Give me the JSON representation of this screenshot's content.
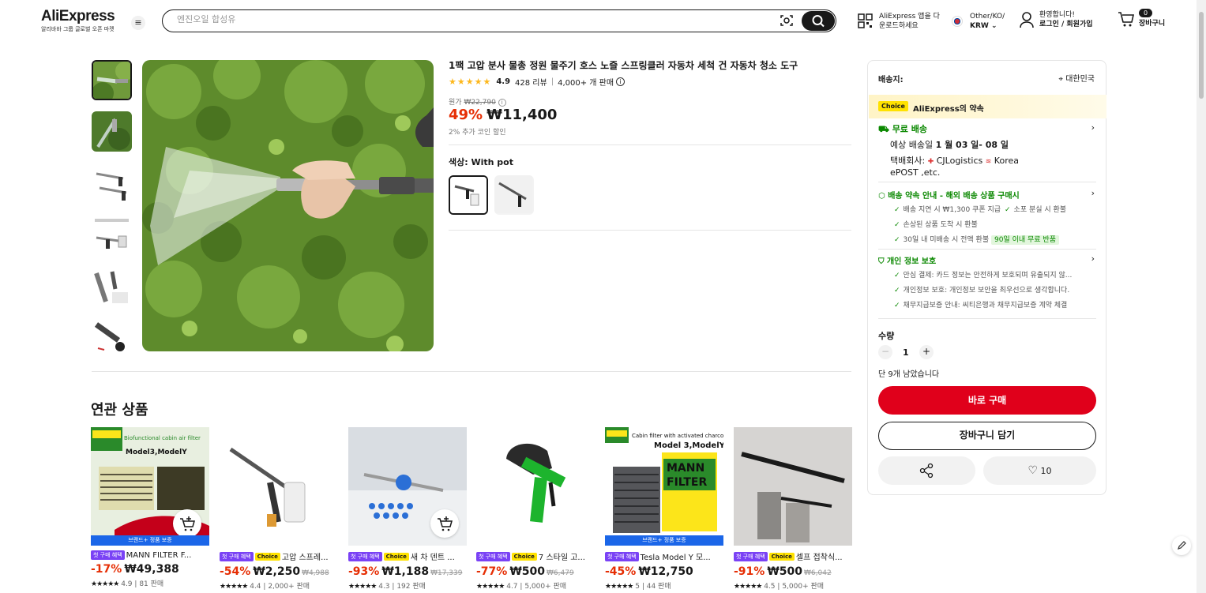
{
  "header": {
    "logo": "AliExpress",
    "logo_sub": "알리바바 그룹 글로벌 오픈 마켓",
    "search_placeholder": "엔진오일 합성유",
    "app_line1": "AliExpress 앱을 다",
    "app_line2": "운로드하세요",
    "lang_line1": "Other/KO/",
    "lang_line2": "KRW",
    "user_line1": "환영합니다!",
    "user_line2": "로그인 / 회원가입",
    "cart_count": "0",
    "cart_label": "장바구니"
  },
  "product": {
    "title": "1팩 고압 분사 물총 정원 물주기 호스 노즐 스프링클러 자동차 세척 건 자동차 청소 도구",
    "rating": "4.9",
    "reviews": "428 리뷰",
    "sold": "4,000+ 개 판매",
    "orig_label": "원가",
    "orig_price": "₩22,790",
    "discount": "49%",
    "price": "₩11,400",
    "coin_note": "2% 추가 코인 할인",
    "color_label": "색상: With pot"
  },
  "related": {
    "title": "연관 상품",
    "tag_first": "첫 구매 혜택",
    "tag_choice": "Choice",
    "brand_banner": "브랜드+ 정품 보증",
    "items": [
      {
        "name": "MANN FILTER F...",
        "discount": "-17%",
        "price": "₩49,388",
        "orig": "",
        "stars": "★★★★★",
        "rating": "4.9",
        "sold": "81 판매"
      },
      {
        "name": "고압 스프레...",
        "discount": "-54%",
        "price": "₩2,250",
        "orig": "₩4,988",
        "stars": "★★★★★",
        "rating": "4.4",
        "sold": "2,000+ 판매"
      },
      {
        "name": "새 차 덴트 ...",
        "discount": "-93%",
        "price": "₩1,188",
        "orig": "₩17,339",
        "stars": "★★★★★",
        "rating": "4.3",
        "sold": "192 판매"
      },
      {
        "name": "7 스타일 고...",
        "discount": "-77%",
        "price": "₩500",
        "orig": "₩6,479",
        "stars": "★★★★★",
        "rating": "4.7",
        "sold": "5,000+ 판매"
      },
      {
        "name": "Tesla Model Y 모...",
        "discount": "-45%",
        "price": "₩12,750",
        "orig": "",
        "stars": "★★★★★",
        "rating": "5",
        "sold": "44 판매"
      },
      {
        "name": "셀프 접착식...",
        "discount": "-91%",
        "price": "₩500",
        "orig": "₩6,042",
        "stars": "★★★★★",
        "rating": "4.5",
        "sold": "5,000+ 판매"
      }
    ]
  },
  "side": {
    "ship_to_label": "배송지:",
    "ship_to": "대한민국",
    "choice_tag": "Choice",
    "promise": "AliExpress의 약속",
    "free_ship": "무료 배송",
    "eta_prefix": "예상 배송일",
    "eta": "1 월 03 일- 08 일",
    "courier_label": "택배회사:",
    "courier1": "CJLogistics",
    "courier2": "Korea",
    "courier3": "ePOST ,etc.",
    "guarantee_title": "배송 약속 안내 - 해외 배송 상품 구매시",
    "g1": "배송 지연 시 ₩1,300 쿠폰 지급",
    "g2": "소포 분실 시 환불",
    "g3": "손상된 상품 도착 시 환불",
    "g4": "30일 내 미배송 시 전액 환불",
    "g4_badge": "90일 이내 무료 반품",
    "privacy_title": "개인 정보 보호",
    "p1": "안심 결제: 카드 정보는 안전하게 보호되며 유출되지 않...",
    "p2": "개인정보 보호: 개인정보 보안을 최우선으로 생각합니다.",
    "p3": "채무지급보증 안내: 씨티은행과 채무지급보증 계약 체결",
    "qty_label": "수량",
    "qty": "1",
    "stock": "단 9개 남았습니다",
    "buy_now": "바로 구매",
    "add_cart": "장바구니 담기",
    "wish_count": "10"
  },
  "colors": {
    "accent": "#e0001b",
    "price_red": "#e62e04",
    "green": "#0a8800",
    "choice_yellow": "#ffe200",
    "brand_blue": "#1b66e8"
  }
}
